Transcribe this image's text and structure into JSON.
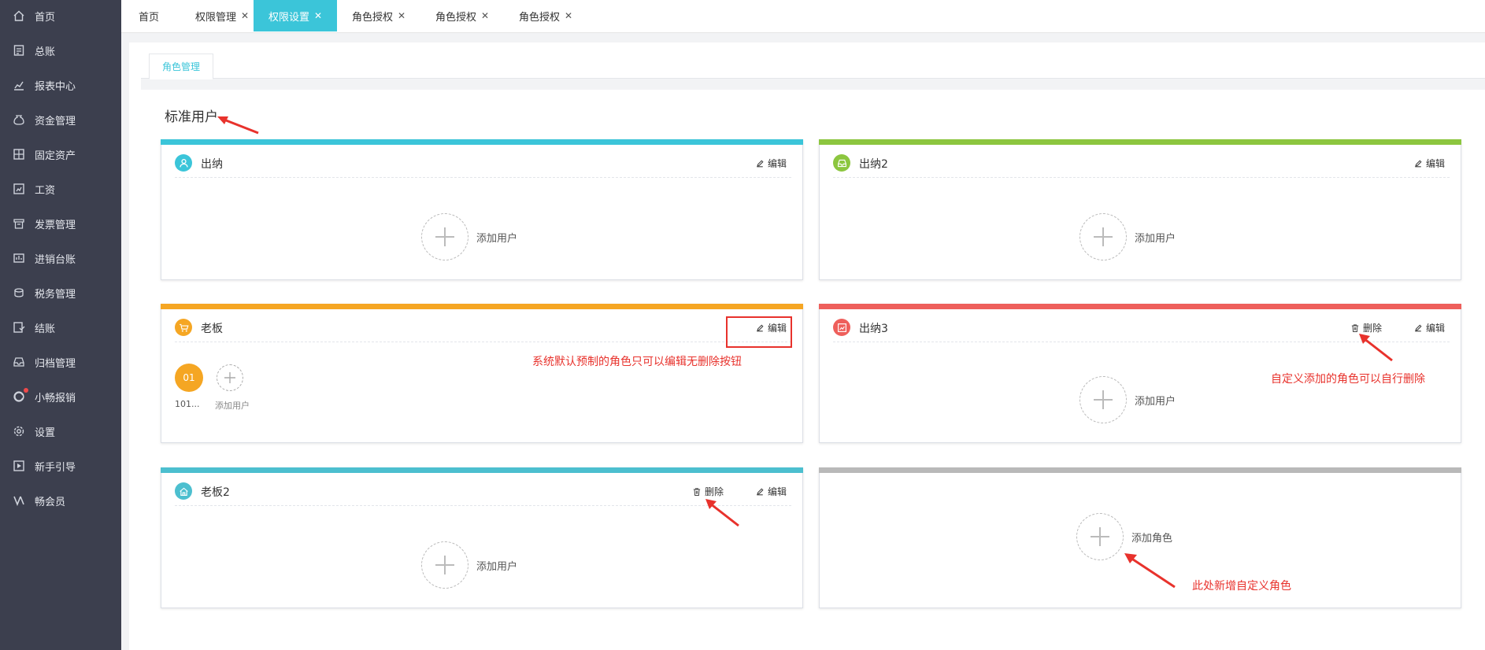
{
  "sidebar": {
    "items": [
      {
        "label": "首页",
        "icon": "home-icon"
      },
      {
        "label": "总账",
        "icon": "ledger-icon"
      },
      {
        "label": "报表中心",
        "icon": "chart-icon"
      },
      {
        "label": "资金管理",
        "icon": "money-bag-icon"
      },
      {
        "label": "固定资产",
        "icon": "assets-icon"
      },
      {
        "label": "工资",
        "icon": "salary-icon"
      },
      {
        "label": "发票管理",
        "icon": "invoice-icon"
      },
      {
        "label": "进销台账",
        "icon": "inventory-icon"
      },
      {
        "label": "税务管理",
        "icon": "tax-icon"
      },
      {
        "label": "结账",
        "icon": "closing-icon"
      },
      {
        "label": "归档管理",
        "icon": "archive-icon"
      },
      {
        "label": "小畅报销",
        "icon": "reimburse-icon"
      },
      {
        "label": "设置",
        "icon": "gear-icon"
      },
      {
        "label": "新手引导",
        "icon": "guide-icon"
      },
      {
        "label": "畅会员",
        "icon": "vip-icon"
      }
    ]
  },
  "tabs": [
    {
      "label": "首页",
      "closable": false,
      "active": false
    },
    {
      "label": "权限管理",
      "closable": true,
      "active": false
    },
    {
      "label": "权限设置",
      "closable": true,
      "active": true
    },
    {
      "label": "角色授权",
      "closable": true,
      "active": false
    },
    {
      "label": "角色授权",
      "closable": true,
      "active": false
    },
    {
      "label": "角色授权",
      "closable": true,
      "active": false
    }
  ],
  "close_glyph": "✕",
  "subtab": {
    "label": "角色管理"
  },
  "section_title": "标准用户",
  "cards": [
    {
      "name": "出纳",
      "color": "#3bc5d9",
      "edit_label": "编辑",
      "add_user_label": "添加用户"
    },
    {
      "name": "出纳2",
      "color": "#8cc63f",
      "edit_label": "编辑",
      "add_user_label": "添加用户"
    },
    {
      "name": "老板",
      "color": "#f5a623",
      "edit_label": "编辑",
      "user_badge": "01",
      "user_name": "101...",
      "add_user_label": "添加用户"
    },
    {
      "name": "出纳3",
      "color": "#ee5f5b",
      "delete_label": "删除",
      "edit_label": "编辑",
      "add_user_label": "添加用户"
    },
    {
      "name": "老板2",
      "color": "#4cbfcf",
      "delete_label": "删除",
      "edit_label": "编辑",
      "add_user_label": "添加用户"
    },
    {
      "color": "#b9b9b9",
      "add_role_label": "添加角色"
    }
  ],
  "annotations": {
    "preset_note": "系统默认预制的角色只可以编辑无删除按钮",
    "custom_delete_note": "自定义添加的角色可以自行删除",
    "add_role_note": "此处新增自定义角色"
  }
}
